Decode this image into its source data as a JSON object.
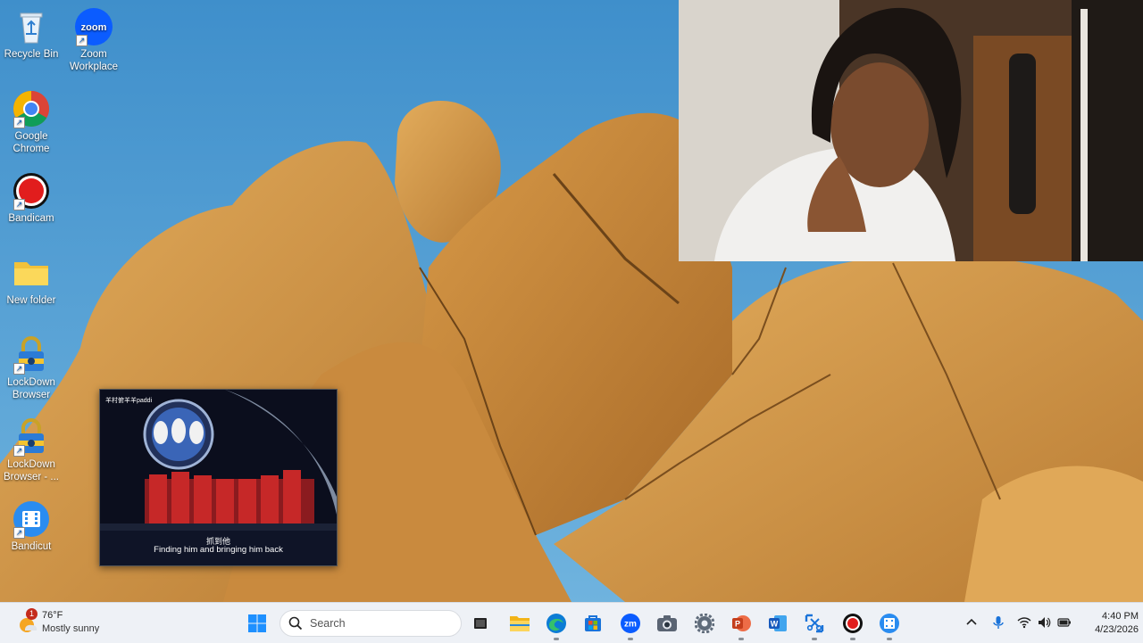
{
  "desktop": {
    "icons": [
      {
        "name": "Recycle Bin",
        "icon": "recycle-bin-icon"
      },
      {
        "name": "Zoom\nWorkplace",
        "icon": "zoom-icon",
        "glyph_text": "zoom"
      },
      {
        "name": "Google\nChrome",
        "icon": "chrome-icon"
      },
      {
        "name": "Bandicam",
        "icon": "bandicam-icon"
      },
      {
        "name": "New folder",
        "icon": "folder-icon"
      },
      {
        "name": "LockDown\nBrowser",
        "icon": "lockdown-browser-icon"
      },
      {
        "name": "LockDown\nBrowser - ...",
        "icon": "lockdown-browser-icon"
      },
      {
        "name": "Bandicut",
        "icon": "bandicut-icon"
      }
    ]
  },
  "video_pip": {
    "channel_text": "羊村俯羊羊paddi",
    "subtitle_cn": "抓到他",
    "subtitle_en": "Finding him and bringing him back"
  },
  "taskbar": {
    "weather": {
      "temp": "76°F",
      "desc": "Mostly sunny",
      "badge": "1",
      "icon": "sun-icon"
    },
    "search_placeholder": "Search",
    "pinned": [
      {
        "name": "start-button",
        "icon": "windows-icon"
      },
      {
        "name": "task-view",
        "icon": "task-view-icon"
      },
      {
        "name": "file-explorer",
        "icon": "folder-icon"
      },
      {
        "name": "edge",
        "icon": "edge-icon"
      },
      {
        "name": "microsoft-store",
        "icon": "store-icon"
      },
      {
        "name": "zoom",
        "icon": "zoom-icon",
        "glyph_text": "zm"
      },
      {
        "name": "camera",
        "icon": "camera-icon"
      },
      {
        "name": "settings",
        "icon": "gear-icon"
      },
      {
        "name": "powerpoint",
        "icon": "powerpoint-icon"
      },
      {
        "name": "word",
        "icon": "word-icon"
      },
      {
        "name": "snipping-tool",
        "icon": "snipping-tool-icon"
      },
      {
        "name": "bandicam",
        "icon": "bandicam-icon"
      },
      {
        "name": "bandicut",
        "icon": "bandicut-icon"
      }
    ],
    "tray": {
      "time": "4:40 PM",
      "date": "4/23/2026"
    }
  },
  "colors": {
    "sky": "#4f98cf",
    "rock": "#d59a4a",
    "taskbar": "#eef1f6",
    "accent_blue": "#0067c0"
  }
}
